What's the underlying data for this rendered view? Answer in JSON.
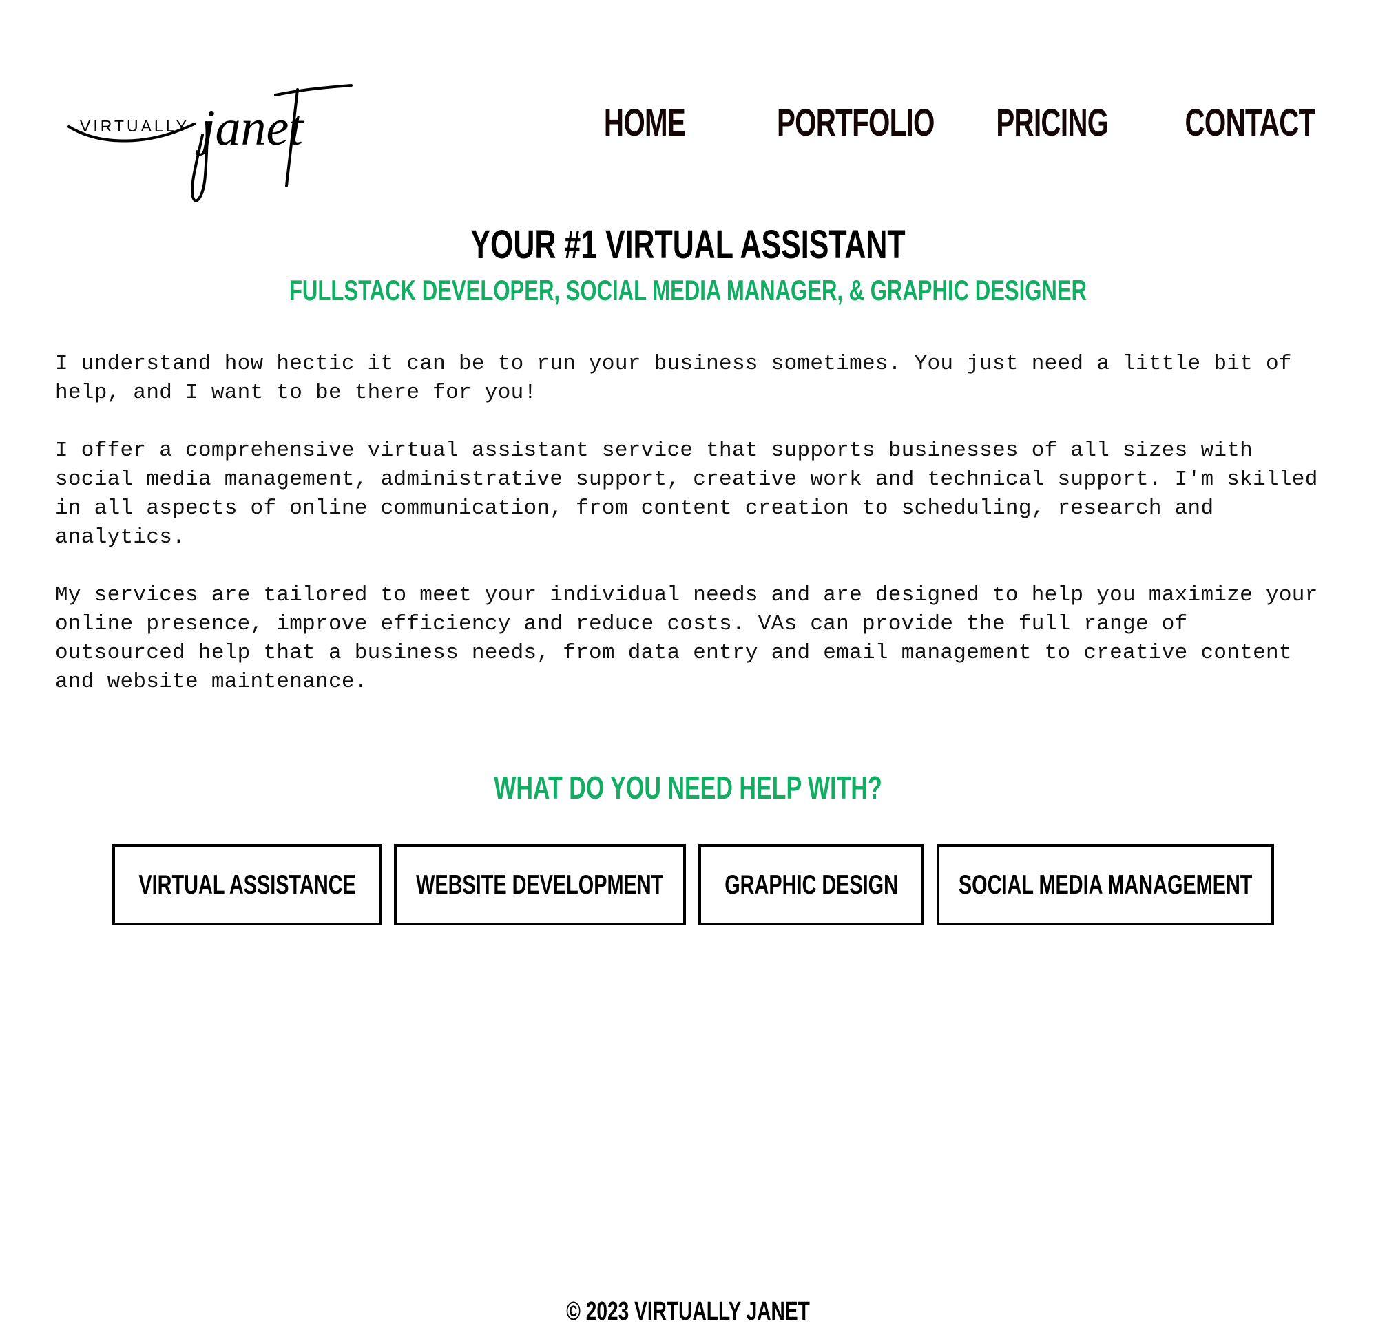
{
  "logo": {
    "text_top": "VIRTUALLY",
    "text_script": "janet"
  },
  "nav": {
    "items": [
      {
        "label": "HOME"
      },
      {
        "label": "PORTFOLIO"
      },
      {
        "label": "PRICING"
      },
      {
        "label": "CONTACT"
      }
    ]
  },
  "hero": {
    "title": "YOUR #1 VIRTUAL ASSISTANT",
    "subtitle": "FULLSTACK DEVELOPER, SOCIAL MEDIA MANAGER, & GRAPHIC DESIGNER"
  },
  "intro": {
    "paragraphs": [
      "I understand how hectic it can be to run your business sometimes. You just need a little bit of help, and I want to be there for you!",
      "I offer a comprehensive virtual assistant service that supports businesses of all sizes with social media management, administrative support, creative work and technical support. I'm skilled in all aspects of online communication, from content creation to scheduling, research and analytics.",
      "My services are tailored to meet your individual needs and are designed to help you maximize your online presence, improve efficiency and reduce costs. VAs can provide the full range of outsourced help that a business needs, from data entry and email management to creative content and website maintenance."
    ]
  },
  "services": {
    "title": "WHAT DO YOU NEED HELP WITH?",
    "buttons": [
      {
        "label": "VIRTUAL ASSISTANCE"
      },
      {
        "label": "WEBSITE DEVELOPMENT"
      },
      {
        "label": "GRAPHIC DESIGN"
      },
      {
        "label": "SOCIAL MEDIA MANAGEMENT"
      }
    ]
  },
  "footer": {
    "copyright": "© 2023 VIRTUALLY JANET"
  },
  "colors": {
    "accent": "#10ad63",
    "text": "#000000",
    "nav_text": "#140606",
    "background": "#ffffff"
  }
}
